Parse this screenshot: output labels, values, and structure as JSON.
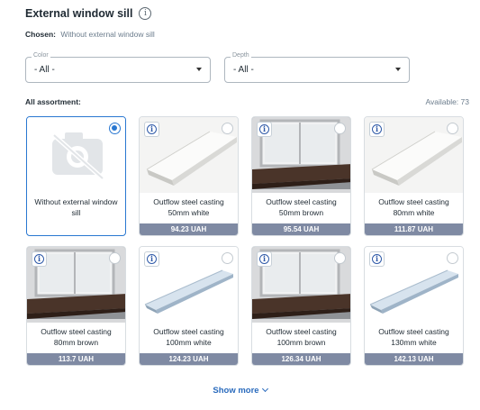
{
  "header": {
    "title": "External window sill",
    "chosen_label": "Chosen:",
    "chosen_value": "Without external window sill"
  },
  "filters": {
    "color": {
      "legend": "Color",
      "value": "- All -"
    },
    "depth": {
      "legend": "Depth",
      "value": "- All -"
    }
  },
  "assortment": {
    "label": "All assortment:",
    "available": "Available: 73"
  },
  "products": [
    {
      "name": "Without external window sill",
      "price": "",
      "image": "no-photo",
      "selected": true
    },
    {
      "name": "Outflow steel casting 50mm white",
      "price": "94.23 UAH",
      "image": "sill-white",
      "selected": false
    },
    {
      "name": "Outflow steel casting 50mm brown",
      "price": "95.54 UAH",
      "image": "window-brown",
      "selected": false
    },
    {
      "name": "Outflow steel casting 80mm white",
      "price": "111.87 UAH",
      "image": "sill-white",
      "selected": false
    },
    {
      "name": "Outflow steel casting 80mm brown",
      "price": "113.7 UAH",
      "image": "window-brown",
      "selected": false
    },
    {
      "name": "Outflow steel casting 100mm white",
      "price": "124.23 UAH",
      "image": "sill-galvanized",
      "selected": false
    },
    {
      "name": "Outflow steel casting 100mm brown",
      "price": "126.34 UAH",
      "image": "window-brown",
      "selected": false
    },
    {
      "name": "Outflow steel casting 130mm white",
      "price": "142.13 UAH",
      "image": "sill-galvanized",
      "selected": false
    }
  ],
  "show_more": "Show more",
  "colors": {
    "accent": "#2a78d1",
    "price_bar": "#7f8aa3",
    "link": "#2a6bbd"
  }
}
